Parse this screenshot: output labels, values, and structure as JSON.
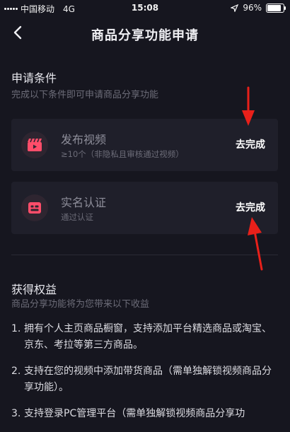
{
  "status_bar": {
    "carrier": "中国移动",
    "network": "4G",
    "time": "15:08",
    "battery": "96%"
  },
  "nav": {
    "title": "商品分享功能申请"
  },
  "conditions": {
    "title": "申请条件",
    "subtitle": "完成以下条件即可申请商品分享功能",
    "items": [
      {
        "title": "发布视频",
        "desc": "≥10个（非隐私且审核通过视频）",
        "action": "去完成",
        "icon": "video-clapper-icon"
      },
      {
        "title": "实名认证",
        "desc": "通过认证",
        "action": "去完成",
        "icon": "id-card-icon"
      }
    ]
  },
  "benefits": {
    "title": "获得权益",
    "subtitle": "商品分享功能将为您带来以下收益",
    "items": [
      {
        "num": "1.",
        "text": "拥有个人主页商品橱窗，支持添加平台精选商品或淘宝、京东、考拉等第三方商品。"
      },
      {
        "num": "2.",
        "text": "支持在您的视频中添加带货商品（需单独解锁视频商品分享功能）。"
      },
      {
        "num": "3.",
        "text": "支持登录PC管理平台（需单独解锁视频商品分享功"
      }
    ]
  },
  "colors": {
    "background": "#16161f",
    "card": "#1f1f2a",
    "icon_accent": "#ff4d6a",
    "arrow": "#e8201a"
  }
}
